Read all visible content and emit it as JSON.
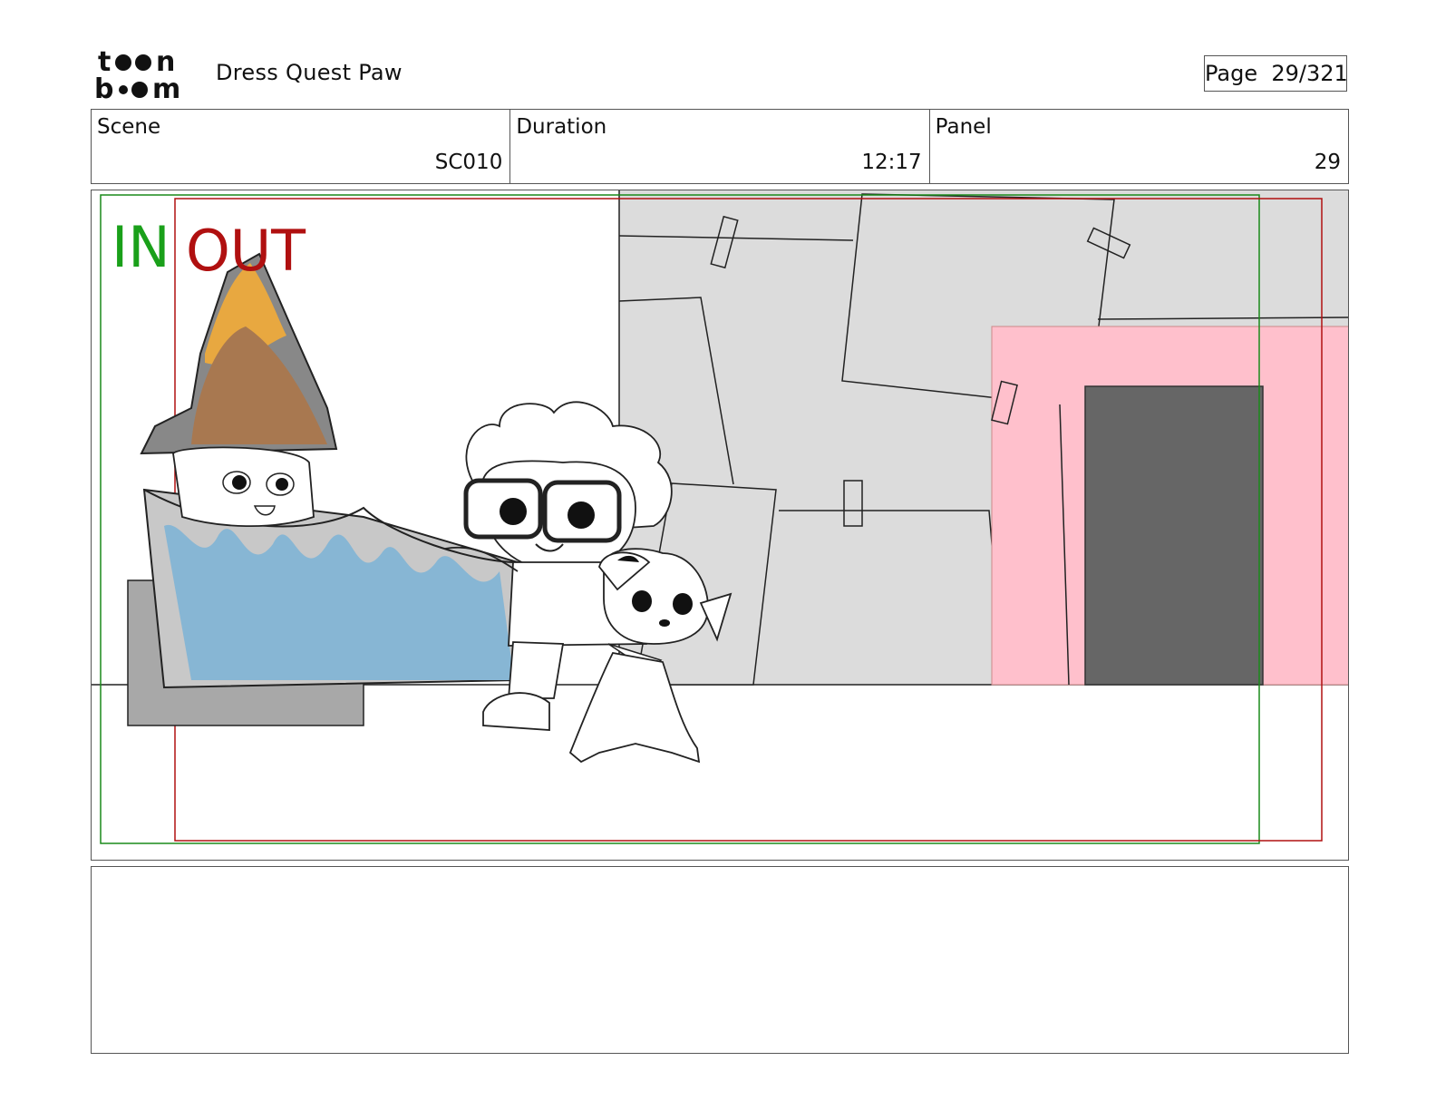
{
  "header": {
    "logo_text": "toon boom",
    "project_title": "Dress Quest Paw",
    "page_label": "Page  29/321"
  },
  "info": [
    {
      "label": "Scene",
      "value": "SC010"
    },
    {
      "label": "Duration",
      "value": "12:17"
    },
    {
      "label": "Panel",
      "value": "29"
    }
  ],
  "panel": {
    "in_label": "IN",
    "out_label": "OUT",
    "colors": {
      "in_frame": "#1a8a1a",
      "out_frame": "#b01010",
      "wall_gray": "#dcdcdc",
      "pink_door": "#ffc0cc",
      "dark_door": "#666666",
      "water_blue": "#87b6d4",
      "orange": "#e8a840",
      "brown": "#a87850"
    }
  },
  "notes": {
    "text": ""
  }
}
